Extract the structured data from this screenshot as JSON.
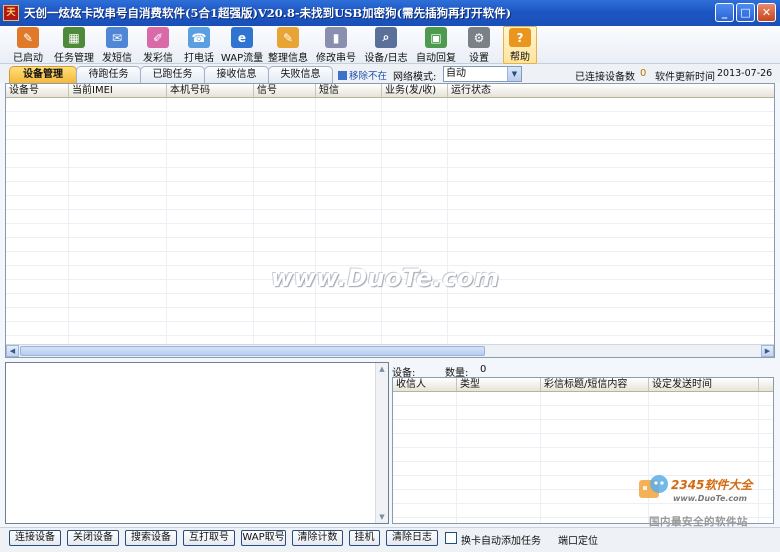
{
  "window": {
    "title": "天创一炫炫卡改串号自消费软件(5合1超强版)V20.8-未找到USB加密狗(需先插狗再打开软件)",
    "app_icon_text": "天",
    "controls": {
      "minimize": "_",
      "maximize": "□",
      "close": "✕"
    }
  },
  "toolbar": {
    "items": [
      {
        "label": "已启动",
        "icon": "start-icon",
        "color": "#e07a2a",
        "glyph": "✎"
      },
      {
        "label": "任务管理",
        "icon": "task-manager-icon",
        "color": "#4f8a3a",
        "glyph": "▦"
      },
      {
        "label": "发短信",
        "icon": "sms-icon",
        "color": "#4f86d6",
        "glyph": "✉"
      },
      {
        "label": "发彩信",
        "icon": "mms-icon",
        "color": "#d96aa8",
        "glyph": "✐"
      },
      {
        "label": "打电话",
        "icon": "phone-icon",
        "color": "#5aa0e0",
        "glyph": "☎"
      },
      {
        "label": "WAP流量",
        "icon": "ie-browser-icon",
        "color": "#2f74d0",
        "glyph": "e"
      },
      {
        "label": "整理信息",
        "icon": "organize-icon",
        "color": "#e8a435",
        "glyph": "✎"
      },
      {
        "label": "修改串号",
        "icon": "edit-imei-icon",
        "color": "#8a8fb0",
        "glyph": "▮"
      },
      {
        "label": "设备/日志",
        "icon": "device-log-icon",
        "color": "#5a6f99",
        "glyph": "⌕"
      },
      {
        "label": "自动回复",
        "icon": "auto-reply-icon",
        "color": "#4d9a50",
        "glyph": "▣"
      },
      {
        "label": "设置",
        "icon": "settings-icon",
        "color": "#7b7f86",
        "glyph": "⚙"
      },
      {
        "label": "帮助",
        "icon": "help-icon",
        "color": "#e8961e",
        "glyph": "?"
      }
    ]
  },
  "tabs": [
    {
      "label": "设备管理",
      "active": true
    },
    {
      "label": "待跑任务",
      "active": false
    },
    {
      "label": "已跑任务",
      "active": false
    },
    {
      "label": "接收信息",
      "active": false
    },
    {
      "label": "失败信息",
      "active": false
    }
  ],
  "tabbar_extra": {
    "remove_offline": "移除不在",
    "network_mode_label": "网络模式:",
    "network_mode_value": "自动",
    "connected_label": "已连接设备数",
    "connected_count": "0",
    "update_label": "软件更新时间",
    "update_date": "2013-07-26"
  },
  "device_table": {
    "columns": [
      "设备号",
      "当前IMEI",
      "本机号码",
      "信号",
      "短信",
      "业务(发/收)",
      "运行状态"
    ],
    "rows": []
  },
  "watermark": "www.DuoTe.com",
  "schedule": {
    "device_label": "设备:",
    "quantity_label": "数量:",
    "quantity_value": "0",
    "columns": [
      "收信人",
      "类型",
      "彩信标题/短信内容",
      "设定发送时间"
    ],
    "rows": []
  },
  "badge": {
    "title": "2345软件大全",
    "url": "www.DuoTe.com",
    "subtitle": "国内最安全的软件站"
  },
  "bottom_bar": {
    "buttons": [
      "连接设备",
      "关闭设备",
      "搜索设备",
      "互打取号",
      "WAP取号",
      "清除计数",
      "挂机",
      "清除日志"
    ],
    "auto_add_task_label": "换卡自动添加任务",
    "auto_add_task_checked": false,
    "port_locate_label": "端口定位"
  },
  "colors": {
    "title_bar": "#1d56c4",
    "active_tab": "#f6b73a",
    "connected_count": "#c07000",
    "badge_title": "#d36a10"
  }
}
